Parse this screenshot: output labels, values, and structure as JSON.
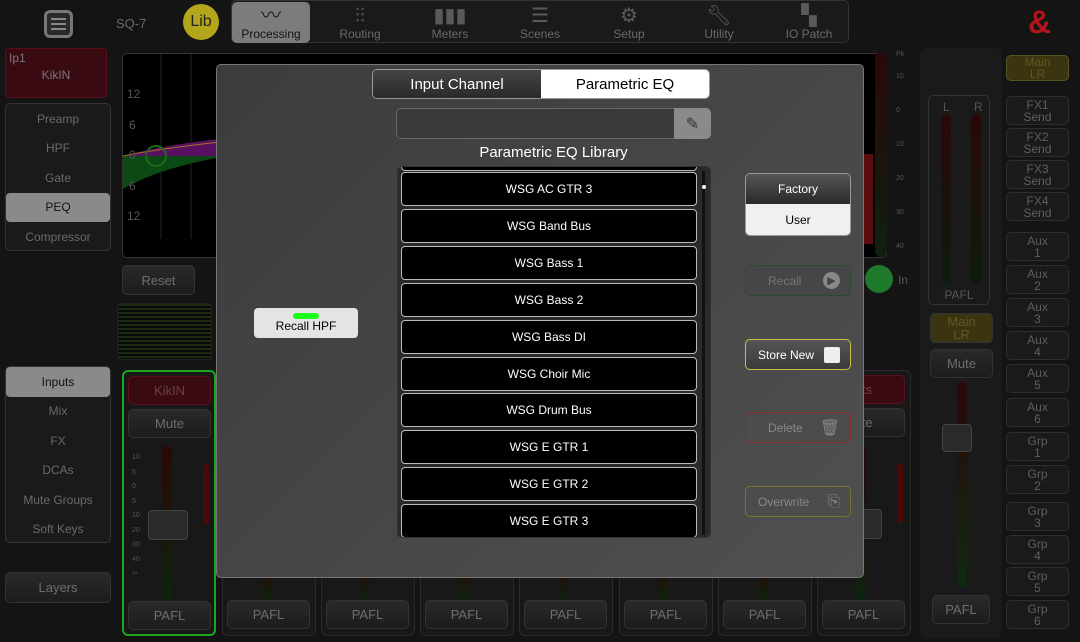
{
  "header": {
    "device": "SQ-7",
    "lib_label": "Lib",
    "logo": "&",
    "tabs": [
      {
        "label": "Processing",
        "icon": "peq-curve-icon",
        "active": true
      },
      {
        "label": "Routing",
        "icon": "faders-icon"
      },
      {
        "label": "Meters",
        "icon": "meters-icon"
      },
      {
        "label": "Scenes",
        "icon": "list-icon"
      },
      {
        "label": "Setup",
        "icon": "gear-icon"
      },
      {
        "label": "Utility",
        "icon": "wrench-icon"
      },
      {
        "label": "IO Patch",
        "icon": "patch-icon"
      }
    ]
  },
  "channel": {
    "id": "Ip1",
    "name": "KikIN"
  },
  "processing_menu": [
    "Preamp",
    "HPF",
    "Gate",
    "PEQ",
    "Compressor"
  ],
  "processing_active": "PEQ",
  "nav_menu": [
    "Inputs",
    "Mix",
    "FX",
    "DCAs",
    "Mute Groups",
    "Soft Keys"
  ],
  "nav_active": "Inputs",
  "layers_label": "Layers",
  "eq_graph": {
    "y_ticks": [
      "12",
      "6",
      "0",
      "6",
      "12"
    ]
  },
  "reset_label": "Reset",
  "in_label": "In",
  "meter_scale": [
    "Pk",
    "10",
    "0",
    "10",
    "20",
    "30",
    "40"
  ],
  "strips": [
    {
      "name": "KikIN",
      "mute": "Mute",
      "pafl": "PAFL",
      "selected": true
    },
    {
      "pafl": "PAFL"
    },
    {
      "pafl": "PAFL"
    },
    {
      "pafl": "PAFL"
    },
    {
      "pafl": "PAFL"
    },
    {
      "pafl": "PAFL"
    },
    {
      "pafl": "PAFL"
    },
    {
      "name": "ats",
      "mute": "ute",
      "pafl": "PAFL"
    }
  ],
  "fader_scale": [
    "10",
    "5",
    "0",
    "5",
    "10",
    "20",
    "30",
    "40",
    "∞"
  ],
  "master": {
    "L": "L",
    "R": "R",
    "pafl": "PAFL",
    "main": "Main LR",
    "mute": "Mute",
    "pafl2": "PAFL"
  },
  "mix_buttons": [
    "Main LR",
    "FX1 Send",
    "FX2 Send",
    "FX3 Send",
    "FX4 Send",
    "Aux 1",
    "Aux 2",
    "Aux 3",
    "Aux 4",
    "Aux 5",
    "Aux 6",
    "Grp 1",
    "Grp 2",
    "Grp 3",
    "Grp 4",
    "Grp 5",
    "Grp 6"
  ],
  "modal": {
    "tabs": [
      "Input Channel",
      "Parametric EQ"
    ],
    "active_tab": "Parametric EQ",
    "name_input": {
      "value": "",
      "placeholder": ""
    },
    "library_title": "Parametric EQ Library",
    "items": [
      "WSG AC GTR 3",
      "WSG Band Bus",
      "WSG Bass 1",
      "WSG Bass 2",
      "WSG Bass DI",
      "WSG Choir Mic",
      "WSG Drum Bus",
      "WSG E GTR 1",
      "WSG E GTR 2",
      "WSG E GTR 3"
    ],
    "source": [
      "Factory",
      "User"
    ],
    "source_active": "Factory",
    "recall_hpf": "Recall HPF",
    "recall": "Recall",
    "store_new": "Store New",
    "delete": "Delete",
    "overwrite": "Overwrite"
  },
  "colors": {
    "lib": "#b3a61b",
    "logo": "#b0151c",
    "channel_red": "#3a0a12",
    "select_green": "#1fa51f",
    "store_border": "#c8c040",
    "delete_border": "#8a2b2b",
    "overwrite_border": "#7a7330",
    "hpf_led": "#19ff19"
  }
}
